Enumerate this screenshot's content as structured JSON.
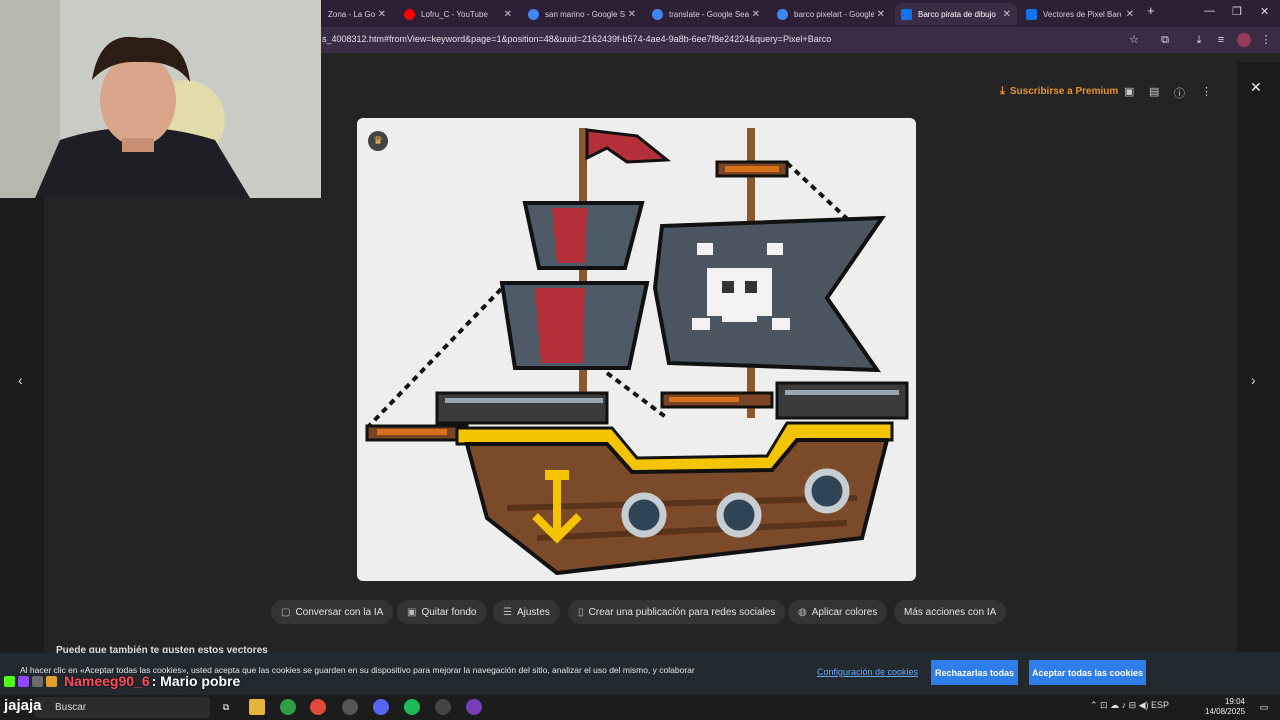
{
  "tabs": [
    {
      "title": "Zona - La Go",
      "fav": "#e0e0e0"
    },
    {
      "title": "Lofru_C - YouTube",
      "fav": "#ff0000"
    },
    {
      "title": "san marino - Google Se",
      "fav": "#4285f4"
    },
    {
      "title": "translate - Google Sear",
      "fav": "#4285f4"
    },
    {
      "title": "barco pixelart - Google",
      "fav": "#4285f4"
    },
    {
      "title": "Barco pirata de dibujos",
      "fav": "#1273eb"
    },
    {
      "title": "Vectores de Pixel Barco",
      "fav": "#1273eb"
    }
  ],
  "address": {
    "url": "s_4008312.htm#fromView=keyword&page=1&position=48&uuid=2162439f-b574-4ae4-9a8b-6ee7f8e24224&query=Pixel+Barco"
  },
  "viewer": {
    "premium_label": "Suscribirse a Premium",
    "chips": [
      {
        "label": "Conversar con la IA",
        "icon": "chat-icon"
      },
      {
        "label": "Quitar fondo",
        "icon": "eraser-icon"
      },
      {
        "label": "Ajustes",
        "icon": "sliders-icon"
      },
      {
        "label": "Crear una publicación para redes sociales",
        "icon": "phone-icon"
      },
      {
        "label": "Aplicar colores",
        "icon": "palette-icon"
      },
      {
        "label": "Más acciones con IA",
        "icon": ""
      }
    ],
    "also_like": "Puede que también te gusten estos vectores"
  },
  "cookie": {
    "text": "Al hacer clic en «Aceptar todas las cookies», usted acepta que las cookies se guarden en su dispositivo para mejorar la navegación del sitio, analizar el uso del mismo, y colaborar",
    "config": "Configuración de cookies",
    "reject": "Rechazarlas todas",
    "accept": "Aceptar todas las cookies"
  },
  "chat": {
    "name": "Nameeg90_6",
    "message": ": Mario pobre"
  },
  "taskbar": {
    "jaja": "jajaja",
    "search": "Buscar",
    "lang": "ESP",
    "time": "19:04",
    "date": "14/08/2025"
  },
  "colors": {
    "accent_premium": "#e8912d",
    "cookie_button": "#2e7de9",
    "chat_name": "#ff4b5c"
  }
}
